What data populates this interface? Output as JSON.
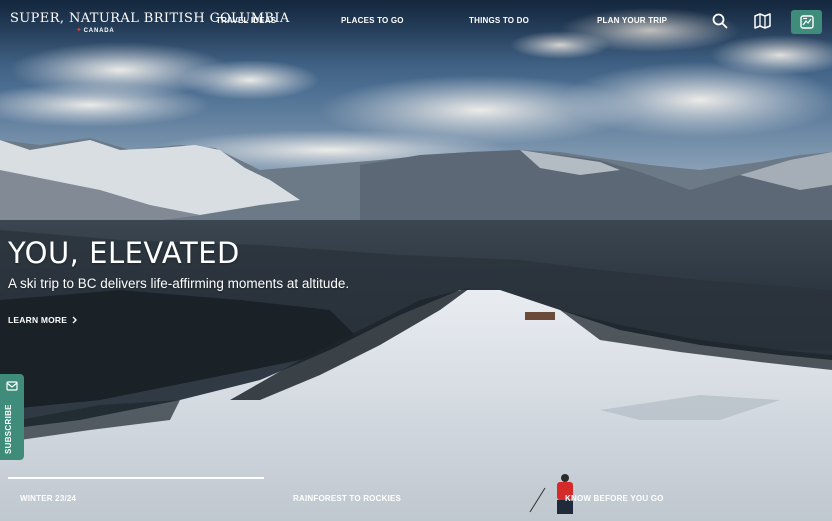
{
  "header": {
    "logo_text": "SUPER, NATURAL BRITISH COLUMBIA",
    "logo_subtext": "CANADA",
    "nav": [
      {
        "label": "TRAVEL IDEAS"
      },
      {
        "label": "PLACES TO GO"
      },
      {
        "label": "THINGS TO DO"
      },
      {
        "label": "PLAN YOUR TRIP"
      }
    ],
    "icons": {
      "search": "search-icon",
      "map": "map-icon",
      "passport": "passport-icon"
    }
  },
  "hero": {
    "headline": "YOU, ELEVATED",
    "subhead": "A ski trip to BC delivers life-affirming moments at altitude.",
    "cta_label": "LEARN MORE",
    "cta_icon": "chevron-right-icon"
  },
  "subscribe": {
    "label": "SUBSCRIBE",
    "icon": "mail-icon"
  },
  "slider": {
    "progress": 0.32,
    "tabs": [
      {
        "label": "WINTER 23/24"
      },
      {
        "label": "RAINFOREST TO ROCKIES"
      },
      {
        "label": "KNOW BEFORE YOU GO"
      }
    ]
  },
  "colors": {
    "accent": "#3f8c7b",
    "flag_red": "#e03c31",
    "skier_jacket": "#d42a2a"
  }
}
